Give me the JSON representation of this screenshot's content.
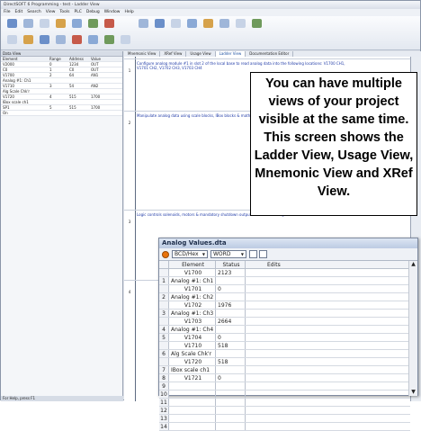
{
  "app": {
    "title": "DirectSOFT 6 Programming - test - Ladder View"
  },
  "menu": [
    "File",
    "Edit",
    "Search",
    "View",
    "Tools",
    "PLC",
    "Debug",
    "Window",
    "Help"
  ],
  "tabs": [
    "Mnemonic View",
    "XRef View",
    "Usage View",
    "Ladder View",
    "Documentation Editor"
  ],
  "left_panel": {
    "header": "Data View",
    "columns": [
      "Element",
      "Range",
      "Address",
      "Value"
    ],
    "rows": [
      {
        "el": "V2000",
        "range": "0",
        "addr": "1234",
        "val": "OUT"
      },
      {
        "el": "C0",
        "range": "1",
        "addr": "C0",
        "val": "OUT"
      },
      {
        "el": "V1700",
        "range": "2",
        "addr": "64",
        "val": "AN1"
      },
      {
        "el": "Analog #1: Ch1",
        "range": "",
        "addr": "",
        "val": ""
      },
      {
        "el": "V1710",
        "range": "3",
        "addr": "54",
        "val": "AN2"
      },
      {
        "el": "Alg Scale Chk'r",
        "range": "",
        "addr": "",
        "val": ""
      },
      {
        "el": "V1720",
        "range": "4",
        "addr": "515",
        "val": "1700"
      },
      {
        "el": "IBox scale ch1",
        "range": "",
        "addr": "",
        "val": ""
      },
      {
        "el": "SP1",
        "range": "5",
        "addr": "515",
        "val": "1700"
      },
      {
        "el": "On",
        "range": "",
        "addr": "",
        "val": ""
      }
    ],
    "status": "For Help, press F1"
  },
  "ladder": {
    "rungs": [
      {
        "num": "1",
        "comment": "Configure analog module #1 in slot 2 of the local base to read analog data into the following locations: V1700 CH1, V1701 CH2, V1702 CH3, V1703 CH4"
      },
      {
        "num": "2",
        "comment": "Manipulate analog data using scale blocks, IBox blocks & math blocks"
      },
      {
        "num": "3",
        "comment": "Logic controls solenoids, motors & mandatory shutdown outputs based on analog values"
      },
      {
        "num": "4",
        "comment": ""
      }
    ]
  },
  "callout": "You can have multiple views of your project visible at the same time. This screen shows the Ladder View, Usage View, Mnemonic View and XRef View.",
  "analog_values": {
    "title": "Analog Values.dta",
    "format": "BCD/Hex",
    "type": "WORD",
    "columns": [
      "Element",
      "Status",
      "Edits"
    ],
    "rows": [
      {
        "n": "",
        "el": "V1700",
        "st": "2123"
      },
      {
        "n": "1",
        "el": "Analog #1: Ch1",
        "st": ""
      },
      {
        "n": "",
        "el": "V1701",
        "st": "0"
      },
      {
        "n": "2",
        "el": "Analog #1: Ch2",
        "st": ""
      },
      {
        "n": "",
        "el": "V1702",
        "st": "1976"
      },
      {
        "n": "3",
        "el": "Analog #1: Ch3",
        "st": ""
      },
      {
        "n": "",
        "el": "V1703",
        "st": "2664"
      },
      {
        "n": "4",
        "el": "Analog #1: Ch4",
        "st": ""
      },
      {
        "n": "5",
        "el": "V1704",
        "st": "0"
      },
      {
        "n": "",
        "el": "V1710",
        "st": "518"
      },
      {
        "n": "6",
        "el": "Alg Scale Chk'r",
        "st": ""
      },
      {
        "n": "",
        "el": "V1720",
        "st": "518"
      },
      {
        "n": "7",
        "el": "IBox scale ch1",
        "st": ""
      },
      {
        "n": "8",
        "el": "V1721",
        "st": "0"
      },
      {
        "n": "9",
        "el": "",
        "st": ""
      },
      {
        "n": "10",
        "el": "",
        "st": ""
      },
      {
        "n": "11",
        "el": "",
        "st": ""
      },
      {
        "n": "12",
        "el": "",
        "st": ""
      },
      {
        "n": "13",
        "el": "",
        "st": ""
      },
      {
        "n": "14",
        "el": "",
        "st": ""
      }
    ]
  }
}
